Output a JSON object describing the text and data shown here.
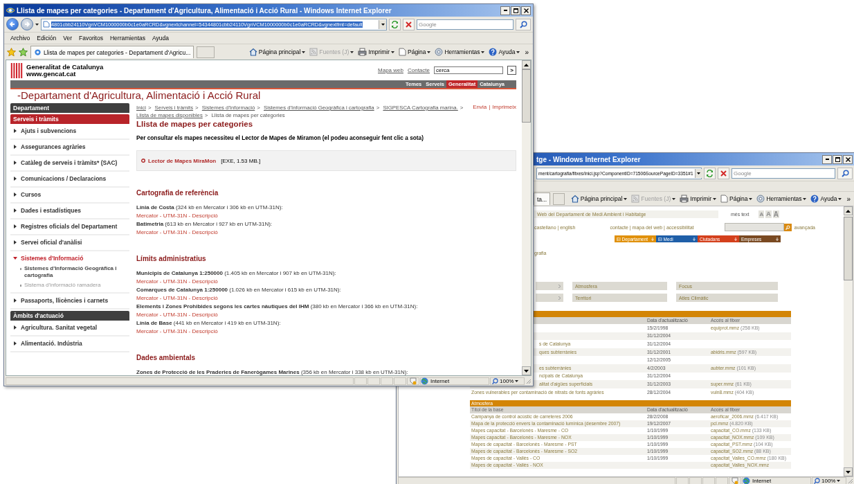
{
  "front_window": {
    "title": "Llista de mapes per categories - Departament d'Agricultura, Alimentació i Acció Rural - Windows Internet Explorer",
    "address": "4801cbb24110VgnVCM1000000b0c1e0aRCRD&vgnextchannel=54344801cbb24110VgnVCM1000000b0c1e0aRCRD&vgnextfmt=default",
    "search_placeholder": "Google",
    "menu": [
      "Archivo",
      "Edición",
      "Ver",
      "Favoritos",
      "Herramientas",
      "Ayuda"
    ],
    "tabs": [
      {
        "label": "Llista de mapes per categories - Departament d'Agricu...",
        "selected": true
      }
    ],
    "command_bar": [
      {
        "label": "Página principal",
        "kind": "home",
        "disabled": false
      },
      {
        "label": "Fuentes (J)",
        "kind": "feeds",
        "disabled": true
      },
      {
        "label": "Imprimir",
        "kind": "print",
        "disabled": false
      },
      {
        "label": "Página",
        "kind": "page",
        "disabled": false
      },
      {
        "label": "Herramientas",
        "kind": "tools",
        "disabled": false
      },
      {
        "label": "Ayuda",
        "kind": "help",
        "disabled": false
      }
    ],
    "overflow": "»",
    "status": {
      "zone": "Internet",
      "zoom": "100%"
    },
    "page": {
      "site": {
        "name": "Generalitat de Catalunya",
        "url": "www.gencat.cat"
      },
      "top_links": [
        "Mapa web",
        "Contacte"
      ],
      "search": {
        "value": "cerca",
        "button": ">"
      },
      "nav": [
        {
          "label": "Temes",
          "selected": false
        },
        {
          "label": "Serveis",
          "selected": false
        },
        {
          "label": "Generalitat",
          "selected": true
        },
        {
          "label": "Catalunya",
          "selected": false
        }
      ],
      "department": "-Departament d'Agricultura, Alimentació i Acció Rural",
      "sidebar": [
        {
          "title": "Departament",
          "selected": false
        },
        {
          "title": "Serveis i tràmits",
          "selected": true,
          "items": [
            {
              "label": "Ajuts i subvencions",
              "expanded": false
            },
            {
              "label": "Assegurances agràries",
              "expanded": false
            },
            {
              "label": "Catàleg de serveis i tràmits* (SAC)",
              "expanded": false
            },
            {
              "label": "Comunicacions / Declaracions",
              "expanded": false
            },
            {
              "label": "Cursos",
              "expanded": false
            },
            {
              "label": "Dades i estadístiques",
              "expanded": false
            },
            {
              "label": "Registres oficials del Departament",
              "expanded": false
            },
            {
              "label": "Servei oficial d'anàlisi",
              "expanded": false
            },
            {
              "label": "Sistemes d'Informació",
              "expanded": true,
              "children": [
                {
                  "label": "Sistemes d'Informació Geogràfica i cartografia",
                  "selected": true
                },
                {
                  "label": "Sistema d'informació ramadera",
                  "selected": false
                }
              ]
            },
            {
              "label": "Passaports, llicències i carnets",
              "expanded": false
            }
          ]
        },
        {
          "title": "Àmbits d'actuació",
          "selected": false,
          "items": [
            {
              "label": "Agricultura. Sanitat vegetal",
              "expanded": false
            },
            {
              "label": "Alimentació. Indústria",
              "expanded": false
            }
          ]
        }
      ],
      "breadcrumb": {
        "separator": ">",
        "items": [
          {
            "label": "Inici",
            "link": true
          },
          {
            "label": "Serveis i tràmits",
            "link": true
          },
          {
            "label": "Sistemes d'Informació",
            "link": true
          },
          {
            "label": "Sistemes d'Informació Geogràfica i cartografia",
            "link": true
          },
          {
            "label": "SIGPESCA Cartografia marina.",
            "link": true
          },
          {
            "label": "Llista de mapes disponibles",
            "link": true
          },
          {
            "label": "Llista de mapes per categories",
            "link": false
          }
        ]
      },
      "actions": {
        "separator": "|",
        "items": [
          "Envia",
          "Imprimeix"
        ]
      },
      "heading": "Llista de mapes per categories",
      "intro": "Per consultar els mapes necessiteu el Lector de Mapes de Miramon (el podeu aconseguir fent clic a sota)",
      "download": {
        "link": "Lector de Mapes MiraMon",
        "info": "[EXE, 1.53 MB.]"
      },
      "sections": [
        {
          "title": "Cartografia de referència",
          "entries": [
            {
              "text": "**Línia de Costa** (324 kb en Mercator i 306 kb en UTM-31N):",
              "links": "Mercator - UTM-31N - Descripció"
            },
            {
              "text": "**Batimetria** (613 kb en Mercator i 927 kb en UTM-31N):",
              "links": "Mercator - UTM-31N - Descripció"
            }
          ]
        },
        {
          "title": "Límits administratius",
          "entries": [
            {
              "text": "**Municipis de Catalunya 1:250000** (1.405 kb en Mercator i 907 kb en UTM-31N):",
              "links": "Mercator - UTM-31N - Descripció"
            },
            {
              "text": "**Comarques de Catalunya 1:250000** (1.026 kb en Mercator i 615 kb en UTM-31N):",
              "links": "Mercator - UTM-31N - Descripció"
            },
            {
              "text": "**Elements i Zones Prohibides segons les cartes nàutiques del IHM** (380 kb en Mercator i 366 kb en UTM-31N):",
              "links": "Mercator - UTM-31N - Descripció"
            },
            {
              "text": "**Línia de Base** (441 kb en Mercator i 419 kb en UTM-31N):",
              "links": "Mercator - UTM-31N - Descripció"
            }
          ]
        },
        {
          "title": "Dades ambientals",
          "entries": [
            {
              "text": "**Zones de Protecció de les Praderies de Fanerògames Marines** (356 kb en Mercator i 338 kb en UTM-31N):"
            }
          ]
        }
      ]
    }
  },
  "back_window": {
    "title": "tge - Windows Internet Explorer",
    "address": "ment/cartografia/fitxes/inici.jsp?ComponentID=71506SourcePageID=3351#1",
    "search_placeholder": "Google",
    "tab": "ta...",
    "command_bar": [
      {
        "label": "Página principal",
        "kind": "home",
        "disabled": false
      },
      {
        "label": "Fuentes (J)",
        "kind": "feeds",
        "disabled": true
      },
      {
        "label": "Imprimir",
        "kind": "print",
        "disabled": false
      },
      {
        "label": "Página",
        "kind": "page",
        "disabled": false
      },
      {
        "label": "Herramientas",
        "kind": "tools",
        "disabled": false
      },
      {
        "label": "Ayuda",
        "kind": "help",
        "disabled": false
      }
    ],
    "overflow": "»",
    "status": {
      "zone": "Internet",
      "zoom": "100%"
    },
    "page": {
      "site_bar": "Web del Departament de Medi Ambient i Habitatge",
      "more_text": "més text",
      "font_sizes": [
        "A",
        "A",
        "A"
      ],
      "languages": "castellano | english",
      "links": "contacte | mapa del web | accessibilitat",
      "advanced": "avançada",
      "nav": [
        {
          "label": "El Departament",
          "color": "#e0900a"
        },
        {
          "label": "El Medi",
          "color": "#1f5fa8"
        },
        {
          "label": "Ciutadans",
          "color": "#d4401c"
        },
        {
          "label": "Empreses",
          "color": "#7a4a22"
        }
      ],
      "breadcrumb_tail": "grafia",
      "categories": [
        {
          "label": "Atmosfera"
        },
        {
          "label": "Focus"
        },
        {
          "label": "Territori"
        },
        {
          "label": "Atles Climàtic"
        }
      ],
      "tables": [
        {
          "columns": {
            "date": "Data d'actualització",
            "file": "Accés al fitxer"
          },
          "rows": [
            {
              "date": "15/2/1998",
              "file": "equiprot.mmz",
              "size": "(258 KB)"
            },
            {
              "date": "31/12/2004"
            },
            {
              "title": "s de Catalunya",
              "date": "31/12/2004"
            },
            {
              "title": "ques subterrànies",
              "date": "31/12/2001",
              "file": "abidris.mmz",
              "size": "(597 KB)"
            },
            {
              "date": "12/12/2005"
            },
            {
              "title": "es subterrànies",
              "date": "4/2/2003",
              "file": "aubter.mmz",
              "size": "(101 KB)"
            },
            {
              "title": "ncipals de Catalunya",
              "date": "31/12/2004"
            },
            {
              "title": "alitat d'aigües superficials",
              "date": "31/12/2003",
              "file": "super.mmz",
              "size": "(61 KB)"
            },
            {
              "title": "Zones vulnerables per contaminació de nitrats de fonts agràries",
              "date": "28/12/2004",
              "file": "vuln8.mmz",
              "size": "(404 KB)"
            }
          ]
        },
        {
          "caption": "Atmosfera",
          "columns": {
            "title": "Títol de la base",
            "date": "Data d'actualització",
            "file": "Accés al fitxer"
          },
          "rows": [
            {
              "title": "Campanya de control acústic de carreteres 2006",
              "date": "28/2/2008",
              "file": "aeroficar_2006.mmz",
              "size": "(6.417 KB)"
            },
            {
              "title": "Mapa de la protecció envers la contaminació lumínica (desembre 2007)",
              "date": "19/12/2007",
              "file": "pcl.mmz",
              "size": "(4.820 KB)"
            },
            {
              "title": "Mapes capacitat - Barcelonès - Maresme - CO",
              "date": "1/10/1999",
              "file": "capacitat_CO.mmz",
              "size": "(133 KB)"
            },
            {
              "title": "Mapes capacitat - Barcelonès - Maresme - NOX",
              "date": "1/10/1999",
              "file": "capacitat_NOX.mmz",
              "size": "(109 KB)"
            },
            {
              "title": "Mapes de capacitat - Barcelonès - Maresme - PST",
              "date": "1/10/1999",
              "file": "capacitat_PST.mmz",
              "size": "(104 KB)"
            },
            {
              "title": "Mapes de capacitat - Barcelonès - Maresme - SO2",
              "date": "1/10/1999",
              "file": "capacitat_SO2.mmz",
              "size": "(88 KB)"
            },
            {
              "title": "Mapes de capacitat - Vallès - CO",
              "date": "1/10/1999",
              "file": "capacitat_Valles_CO.mmz",
              "size": "(180 KB)"
            },
            {
              "title": "Mapes de capacitat - Vallès - NOX",
              "file": "capacitat_Valles_NOX.mmz"
            }
          ]
        }
      ]
    }
  }
}
